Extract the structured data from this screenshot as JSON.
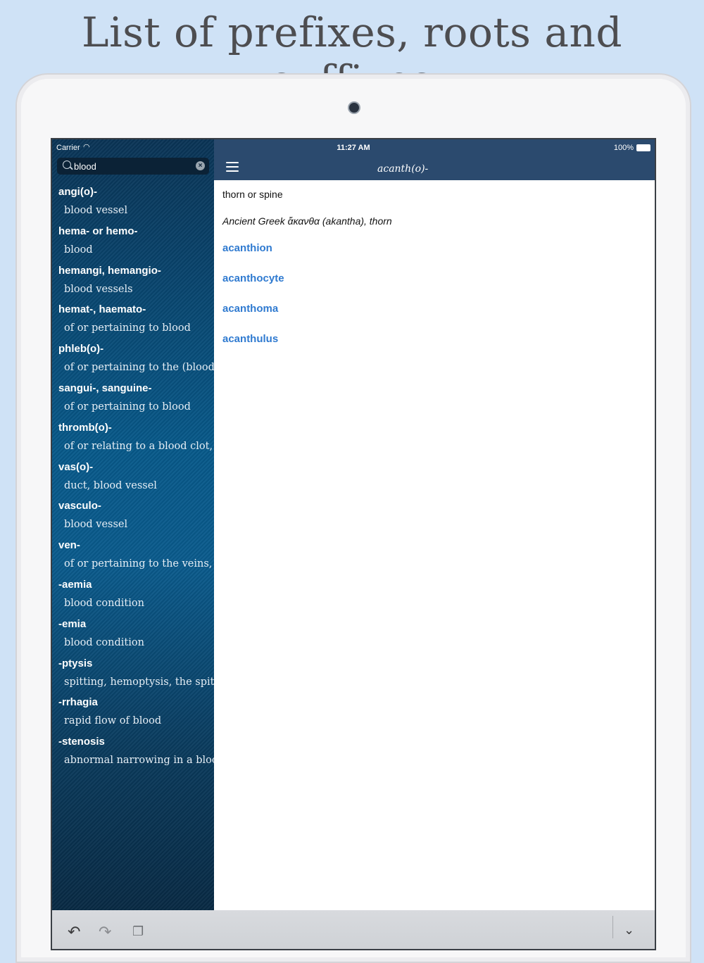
{
  "promo": {
    "title": "List of prefixes, roots and suffixes"
  },
  "status_bar": {
    "carrier": "Carrier",
    "time": "11:27 AM",
    "battery": "100%"
  },
  "search": {
    "value": "blood"
  },
  "results": [
    {
      "term": "angi(o)-",
      "definition": "blood vessel"
    },
    {
      "term": "hema- or hemo-",
      "definition": "blood"
    },
    {
      "term": "hemangi,  hemangio-",
      "definition": "blood vessels"
    },
    {
      "term": "hemat-, haemato-",
      "definition": "of or pertaining to blood"
    },
    {
      "term": "phleb(o)-",
      "definition": "of or pertaining to the (blood) veins"
    },
    {
      "term": "sangui-, sanguine-",
      "definition": "of or pertaining to blood"
    },
    {
      "term": "thromb(o)-",
      "definition": "of or relating to a blood clot, clotting"
    },
    {
      "term": "vas(o)-",
      "definition": "duct, blood vessel"
    },
    {
      "term": "vasculo-",
      "definition": "blood vessel"
    },
    {
      "term": "ven-",
      "definition": "of or pertaining to the veins, venous"
    },
    {
      "term": "-aemia",
      "definition": "blood condition"
    },
    {
      "term": "-emia",
      "definition": "blood condition"
    },
    {
      "term": "-ptysis",
      "definition": "spitting, hemoptysis, the spitting of"
    },
    {
      "term": "-rrhagia",
      "definition": "rapid flow of blood"
    },
    {
      "term": "-stenosis",
      "definition": "abnormal narrowing in a blood vess"
    }
  ],
  "detail": {
    "title": "acanth(o)-",
    "meaning": "thorn or spine",
    "origin": "Ancient Greek ἄκανθα (akantha), thorn",
    "related": [
      "acanthion",
      "acanthocyte",
      "acanthoma",
      "acanthulus"
    ]
  },
  "toolbar": {
    "undo": "↶",
    "redo": "↷",
    "paste": "❐",
    "dismiss": "⌄"
  }
}
